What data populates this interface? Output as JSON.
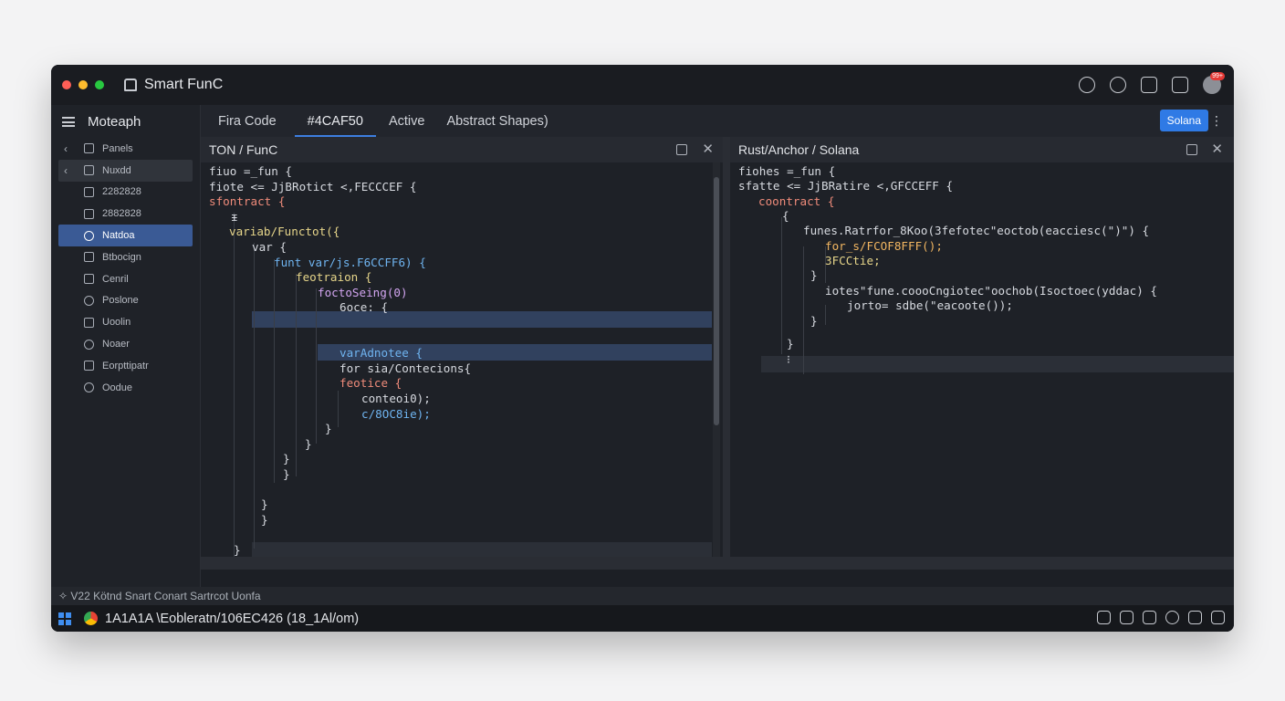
{
  "window": {
    "title": "Smart FunC",
    "traffic_colors": [
      "#ff5f57",
      "#febc2e",
      "#28c840"
    ],
    "avatar_badge": "99+"
  },
  "sidebar": {
    "title": "Moteaph",
    "items": [
      {
        "label": "Panels",
        "icon": "panels-icon",
        "chevron": "‹"
      },
      {
        "label": "Nuxdd",
        "icon": "folder-icon",
        "chevron": "‹"
      },
      {
        "label": "2282828",
        "icon": "file-icon"
      },
      {
        "label": "2882828",
        "icon": "file-icon"
      },
      {
        "label": "Natdoa",
        "icon": "gear-icon"
      },
      {
        "label": "Btbocign",
        "icon": "file-icon"
      },
      {
        "label": "Cenril",
        "icon": "file-icon"
      },
      {
        "label": "Poslone",
        "icon": "shield-icon"
      },
      {
        "label": "Uoolin",
        "icon": "stack-icon"
      },
      {
        "label": "Noaer",
        "icon": "cloud-icon"
      },
      {
        "label": "Eorpttipatr",
        "icon": "plus-box-icon"
      },
      {
        "label": "Oodue",
        "icon": "comment-icon"
      }
    ]
  },
  "tabs": [
    {
      "label": "Fira Code"
    },
    {
      "label": "#4CAF50"
    },
    {
      "label": "Active"
    },
    {
      "label": "Abstract Shapes)"
    }
  ],
  "tab_button": "Solana",
  "left_pane": {
    "title": "TON / FunC",
    "lines": [
      {
        "text": "fiuo =_fun {",
        "cls": "c-w"
      },
      {
        "text": "fiote <= JjBRotict <,FECCCEF {",
        "cls": "c-w"
      },
      {
        "text": "sfontract {",
        "cls": "c-r"
      },
      {
        "text": "ᵻ",
        "cls": "c-w"
      },
      {
        "text": "variab/Functot({",
        "cls": "c-y"
      },
      {
        "text": "var {",
        "cls": "c-w"
      },
      {
        "text": "funt var/js.F6CCFF6) {",
        "cls": "c-b"
      },
      {
        "text": "feotraion {",
        "cls": "c-y"
      },
      {
        "text": "foctoSeing(0)",
        "cls": "c-p"
      },
      {
        "text": "6oce: {",
        "cls": "c-w"
      },
      {
        "text": "",
        "cls": "c-w"
      },
      {
        "text": "",
        "cls": "c-w"
      },
      {
        "text": "varAdnotee {",
        "cls": "c-b"
      },
      {
        "text": "for sia/Contecions{",
        "cls": "c-w"
      },
      {
        "text": "feotice {",
        "cls": "c-r"
      },
      {
        "text": "conteoi0);",
        "cls": "c-w"
      },
      {
        "text": "c/8OC8ie);",
        "cls": "c-b"
      },
      {
        "text": "}",
        "cls": "c-w"
      },
      {
        "text": "}",
        "cls": "c-w"
      },
      {
        "text": "}",
        "cls": "c-w"
      },
      {
        "text": "}",
        "cls": "c-w"
      },
      {
        "text": "",
        "cls": "c-w"
      },
      {
        "text": "}",
        "cls": "c-w"
      },
      {
        "text": "}",
        "cls": "c-w"
      },
      {
        "text": "",
        "cls": "c-w"
      },
      {
        "text": "}",
        "cls": "c-w"
      }
    ]
  },
  "right_pane": {
    "title": "Rust/Anchor / Solana",
    "lines": [
      {
        "text": "fiohes =_fun {",
        "cls": "c-w"
      },
      {
        "text": "sfatte <= JjBRatire <,GFCCEFF {",
        "cls": "c-w"
      },
      {
        "text": "coontract {",
        "cls": "c-r"
      },
      {
        "text": "{",
        "cls": "c-w"
      },
      {
        "text": "",
        "cls": "c-w"
      },
      {
        "text": "funes.Ratrfor_8Koo(3fefotec\"eoctob(eacciesc(\")\") {",
        "cls": "c-w"
      },
      {
        "text": "for_s/FCOF8FFF();",
        "cls": "c-o"
      },
      {
        "text": "3FCCtie;",
        "cls": "c-y"
      },
      {
        "text": "}",
        "cls": "c-w"
      },
      {
        "text": "iotes\"fune.coooCngiotec\"oochob(Isoctoec(yddac) {",
        "cls": "c-w"
      },
      {
        "text": "jorto= sdbe(\"eacoote());",
        "cls": "c-w"
      },
      {
        "text": "}",
        "cls": "c-w"
      },
      {
        "text": "",
        "cls": "c-w"
      },
      {
        "text": "}",
        "cls": "c-w"
      },
      {
        "text": "",
        "cls": "c-w"
      },
      {
        "text": "⁝",
        "cls": "c-w"
      }
    ]
  },
  "status_line": "✧ V22  Kötnd Snart Conart Sartrcot Uonfa",
  "taskbar": {
    "text": "1A1A1A  \\Eobleratn/106EC426 (18_1Al/om)"
  },
  "colors": {
    "accent": "#3d7ee0",
    "sidebar_active": "#3a5a95",
    "button": "#2f7ae5"
  }
}
